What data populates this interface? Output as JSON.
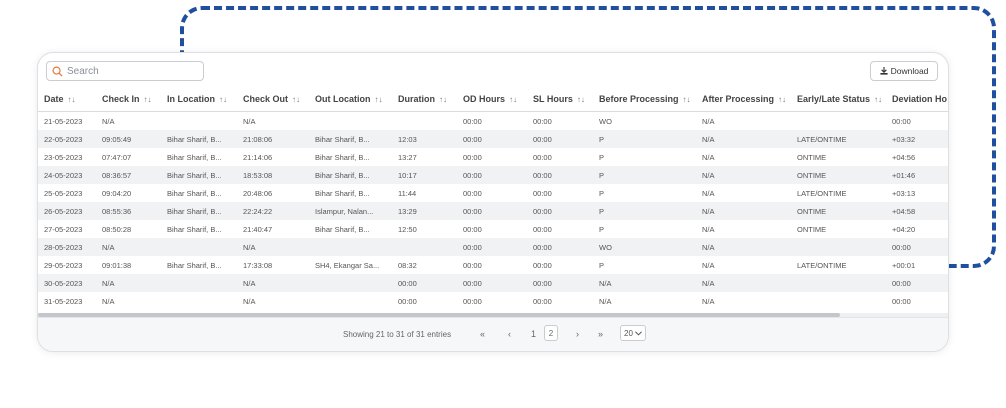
{
  "search": {
    "placeholder": "Search"
  },
  "toolbar": {
    "download_label": "Download"
  },
  "table": {
    "columns": [
      "Date",
      "Check In",
      "In Location",
      "Check Out",
      "Out Location",
      "Duration",
      "OD Hours",
      "SL Hours",
      "Before Processing",
      "After Processing",
      "Early/Late Status",
      "Deviation Ho"
    ],
    "rows": [
      [
        "21-05-2023",
        "N/A",
        "",
        "N/A",
        "",
        "",
        "00:00",
        "00:00",
        "WO",
        "N/A",
        "",
        "00:00"
      ],
      [
        "22-05-2023",
        "09:05:49",
        "Bihar Sharif, B...",
        "21:08:06",
        "Bihar Sharif, B...",
        "12:03",
        "00:00",
        "00:00",
        "P",
        "N/A",
        "LATE/ONTIME",
        "+03:32"
      ],
      [
        "23-05-2023",
        "07:47:07",
        "Bihar Sharif, B...",
        "21:14:06",
        "Bihar Sharif, B...",
        "13:27",
        "00:00",
        "00:00",
        "P",
        "N/A",
        "ONTIME",
        "+04:56"
      ],
      [
        "24-05-2023",
        "08:36:57",
        "Bihar Sharif, B...",
        "18:53:08",
        "Bihar Sharif, B...",
        "10:17",
        "00:00",
        "00:00",
        "P",
        "N/A",
        "ONTIME",
        "+01:46"
      ],
      [
        "25-05-2023",
        "09:04:20",
        "Bihar Sharif, B...",
        "20:48:06",
        "Bihar Sharif, B...",
        "11:44",
        "00:00",
        "00:00",
        "P",
        "N/A",
        "LATE/ONTIME",
        "+03:13"
      ],
      [
        "26-05-2023",
        "08:55:36",
        "Bihar Sharif, B...",
        "22:24:22",
        "Islampur, Nalan...",
        "13:29",
        "00:00",
        "00:00",
        "P",
        "N/A",
        "ONTIME",
        "+04:58"
      ],
      [
        "27-05-2023",
        "08:50:28",
        "Bihar Sharif, B...",
        "21:40:47",
        "Bihar Sharif, B...",
        "12:50",
        "00:00",
        "00:00",
        "P",
        "N/A",
        "ONTIME",
        "+04:20"
      ],
      [
        "28-05-2023",
        "N/A",
        "",
        "N/A",
        "",
        "",
        "00:00",
        "00:00",
        "WO",
        "N/A",
        "",
        "00:00"
      ],
      [
        "29-05-2023",
        "09:01:38",
        "Bihar Sharif, B...",
        "17:33:08",
        "SH4, Ekangar Sa...",
        "08:32",
        "00:00",
        "00:00",
        "P",
        "N/A",
        "LATE/ONTIME",
        "+00:01"
      ],
      [
        "30-05-2023",
        "N/A",
        "",
        "N/A",
        "",
        "00:00",
        "00:00",
        "00:00",
        "N/A",
        "N/A",
        "",
        "00:00"
      ],
      [
        "31-05-2023",
        "N/A",
        "",
        "N/A",
        "",
        "00:00",
        "00:00",
        "00:00",
        "N/A",
        "N/A",
        "",
        "00:00"
      ]
    ]
  },
  "footer": {
    "info": "Showing 21 to 31 of 31 entries",
    "first": "«",
    "prev": "‹",
    "pages": [
      "1",
      "2"
    ],
    "current_page": "2",
    "next": "›",
    "last": "»",
    "page_size": "20"
  },
  "colors": {
    "accent": "#1f4f9e"
  },
  "icons": {
    "search": "search-icon",
    "download": "download-icon",
    "sort": "sort-icon",
    "dropdown": "chevron-down-icon"
  }
}
